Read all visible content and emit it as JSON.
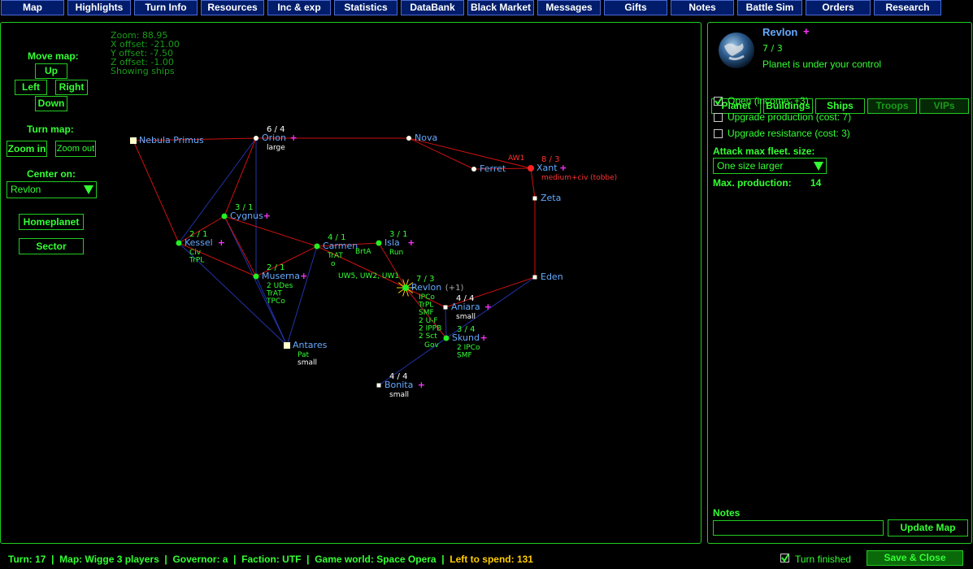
{
  "nav": [
    "Map",
    "Highlights",
    "Turn Info",
    "Resources",
    "Inc & exp",
    "Statistics",
    "DataBank",
    "Black Market",
    "Messages",
    "Gifts",
    "Notes",
    "Battle Sim",
    "Orders",
    "Research"
  ],
  "map_info": [
    "Zoom: 88.95",
    "X offset: -21.00",
    "Y offset: -7.50",
    "Z offset: -1.00",
    "Showing ships"
  ],
  "controls": {
    "move_map": "Move map:",
    "up": "Up",
    "left": "Left",
    "right": "Right",
    "down": "Down",
    "turn_map": "Turn map:",
    "zoom_in": "Zoom in",
    "zoom_out": "Zoom out",
    "center_on": "Center on:",
    "center_value": "Revlon",
    "homeplanet": "Homeplanet",
    "sector": "Sector"
  },
  "colors": {
    "accent": "#33ff33",
    "planet_name": "#66aaff",
    "nav_bg": "#001c6a",
    "enemy": "#ff3333",
    "star_marker": "#ff33ff",
    "highlight": "#ffcc00"
  },
  "planets": [
    {
      "id": "nebula",
      "name": "Nebula Primus",
      "fleet": "",
      "tags": [],
      "star": false,
      "owner": "neutral"
    },
    {
      "id": "orion",
      "name": "Orion",
      "fleet": "6 / 4",
      "tags": [
        "large"
      ],
      "star": true,
      "owner": "neutral"
    },
    {
      "id": "nova",
      "name": "Nova",
      "fleet": "",
      "tags": [],
      "star": false,
      "owner": "neutral"
    },
    {
      "id": "ferret",
      "name": "Ferret",
      "fleet": "",
      "tags": [],
      "star": false,
      "owner": "neutral"
    },
    {
      "id": "xant",
      "name": "Xant",
      "fleet": "8 / 3",
      "tags": [
        "medium+civ (tobbe)"
      ],
      "star": true,
      "owner": "enemy",
      "ship": "AW1"
    },
    {
      "id": "zeta",
      "name": "Zeta",
      "fleet": "",
      "tags": [],
      "star": false,
      "owner": "neutral"
    },
    {
      "id": "cygnus",
      "name": "Cygnus",
      "fleet": "3 / 1",
      "tags": [],
      "star": true,
      "owner": "own"
    },
    {
      "id": "kessel",
      "name": "Kessel",
      "fleet": "2 / 1",
      "tags": [
        "Civ",
        "TrPL"
      ],
      "star": true,
      "owner": "own"
    },
    {
      "id": "carmen",
      "name": "Carmen",
      "fleet": "4 / 1",
      "tags": [
        "TrAT"
      ],
      "star": false,
      "owner": "own"
    },
    {
      "id": "isla",
      "name": "Isla",
      "fleet": "3 / 1",
      "tags": [
        "Run"
      ],
      "star": true,
      "owner": "own",
      "ship": "BrtA"
    },
    {
      "id": "muserna",
      "name": "Muserna",
      "fleet": "2 / 1",
      "tags": [
        "2 UDes",
        "TrAT",
        "TPCo"
      ],
      "star": true,
      "owner": "own"
    },
    {
      "id": "revlon",
      "name": "Revlon",
      "extra": "(+1)",
      "fleet": "7 / 3",
      "tags": [
        "IPCo",
        "TrPL",
        "SMF",
        "2 U-F",
        "2 IPPB",
        "2 Sct"
      ],
      "star": false,
      "owner": "own",
      "ship": "UW5, UW2, UW1"
    },
    {
      "id": "eden",
      "name": "Eden",
      "fleet": "",
      "tags": [],
      "star": false,
      "owner": "neutral"
    },
    {
      "id": "aniara",
      "name": "Aniara",
      "fleet": "4 / 4",
      "tags": [
        "small"
      ],
      "star": true,
      "owner": "neutral"
    },
    {
      "id": "skund",
      "name": "Skund",
      "fleet": "3 / 4",
      "tags": [
        "2 IPCo",
        "SMF"
      ],
      "star": true,
      "owner": "own",
      "ship": "Gov"
    },
    {
      "id": "antares",
      "name": "Antares",
      "fleet": "",
      "tags": [
        "Pat",
        "small"
      ],
      "star": false,
      "owner": "neutral"
    },
    {
      "id": "bonita",
      "name": "Bonita",
      "fleet": "4 / 4",
      "tags": [
        "small"
      ],
      "star": true,
      "owner": "neutral"
    }
  ],
  "star_glyph": "+",
  "carmen_ship": "o",
  "side": {
    "planet_name": "Revlon",
    "fleet": "7 / 3",
    "control": "Planet is under your control",
    "tabs": [
      "Planet",
      "Buildings",
      "Ships",
      "Troops",
      "VIPs"
    ],
    "options": [
      {
        "label": "Open (income: +3)",
        "checked": true
      },
      {
        "label": "Upgrade production (cost: 7)",
        "checked": false
      },
      {
        "label": "Upgrade resistance (cost: 3)",
        "checked": false
      }
    ],
    "attack_label": "Attack max fleet. size:",
    "attack_value": "One size larger",
    "max_prod_label": "Max. production:",
    "max_prod_value": "14",
    "notes_label": "Notes",
    "notes_value": "",
    "update_map": "Update Map"
  },
  "status": {
    "turn": "Turn: 17",
    "map": "Map: Wigge 3 players",
    "governor": "Governor: a",
    "faction": "Faction: UTF",
    "world": "Game world: Space Opera",
    "spend": "Left to spend: 131",
    "turn_finished": "Turn finished",
    "turn_finished_checked": true,
    "save": "Save & Close"
  }
}
